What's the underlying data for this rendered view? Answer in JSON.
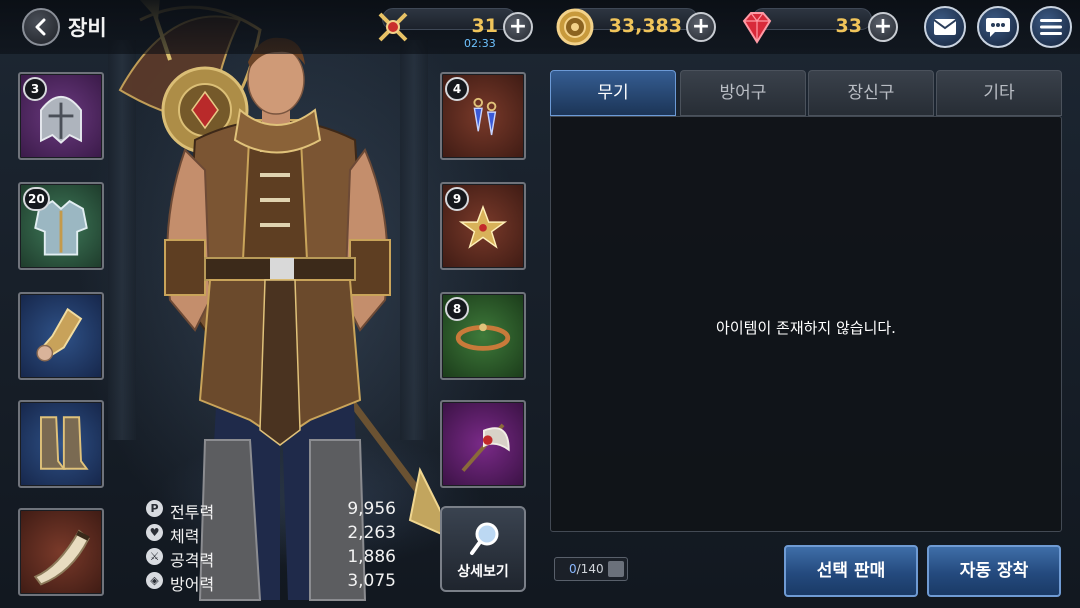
{
  "header": {
    "title": "장비",
    "back_icon": "chevron-left-icon"
  },
  "resources": {
    "stamina": {
      "icon": "crossed-swords-icon",
      "value": "31",
      "timer": "02:33"
    },
    "gold": {
      "icon": "gold-coin-icon",
      "value": "33,383"
    },
    "gems": {
      "icon": "red-gem-icon",
      "value": "33"
    }
  },
  "top_buttons": {
    "mail_icon": "mail-icon",
    "chat_icon": "chat-bubble-icon",
    "menu_icon": "hamburger-menu-icon"
  },
  "equipment_left": [
    {
      "name": "helmet",
      "icon": "knight-helmet-icon",
      "level": "3",
      "bg": "#5a2b6e"
    },
    {
      "name": "chest-armor",
      "icon": "chest-armor-icon",
      "level": "20",
      "bg": "#2f5a44"
    },
    {
      "name": "gloves",
      "icon": "gauntlet-icon",
      "level": "",
      "bg": "#243e66"
    },
    {
      "name": "boots",
      "icon": "greaves-icon",
      "level": "",
      "bg": "#243e66"
    },
    {
      "name": "offhand",
      "icon": "horn-icon",
      "level": "",
      "bg": "#6a3226"
    }
  ],
  "equipment_right": [
    {
      "name": "earrings",
      "icon": "earring-icon",
      "level": "4",
      "bg": "#6a3226"
    },
    {
      "name": "necklace",
      "icon": "star-pendant-icon",
      "level": "9",
      "bg": "#6a3226"
    },
    {
      "name": "bracelet",
      "icon": "bracelet-icon",
      "level": "8",
      "bg": "#2f6a35"
    },
    {
      "name": "weapon",
      "icon": "axe-icon",
      "level": "",
      "bg": "#5a2b6e"
    }
  ],
  "stats": [
    {
      "icon": "P",
      "label": "전투력",
      "value": "9,956"
    },
    {
      "icon": "♥",
      "label": "체력",
      "value": "2,263"
    },
    {
      "icon": "⚔",
      "label": "공격력",
      "value": "1,886"
    },
    {
      "icon": "◈",
      "label": "방어력",
      "value": "3,075"
    }
  ],
  "detail_button": {
    "label": "상세보기",
    "icon": "magnifier-icon"
  },
  "tabs": [
    {
      "label": "무기",
      "active": true
    },
    {
      "label": "방어구",
      "active": false
    },
    {
      "label": "장신구",
      "active": false
    },
    {
      "label": "기타",
      "active": false
    }
  ],
  "inventory": {
    "empty_message": "아이템이 존재하지 않습니다.",
    "used": "0",
    "capacity": "/140"
  },
  "actions": {
    "sell_label": "선택 판매",
    "auto_equip_label": "자동 장착"
  },
  "colors": {
    "accent": "#f0c45a",
    "active_tab": "#355d92",
    "timer": "#6ec3ff"
  }
}
